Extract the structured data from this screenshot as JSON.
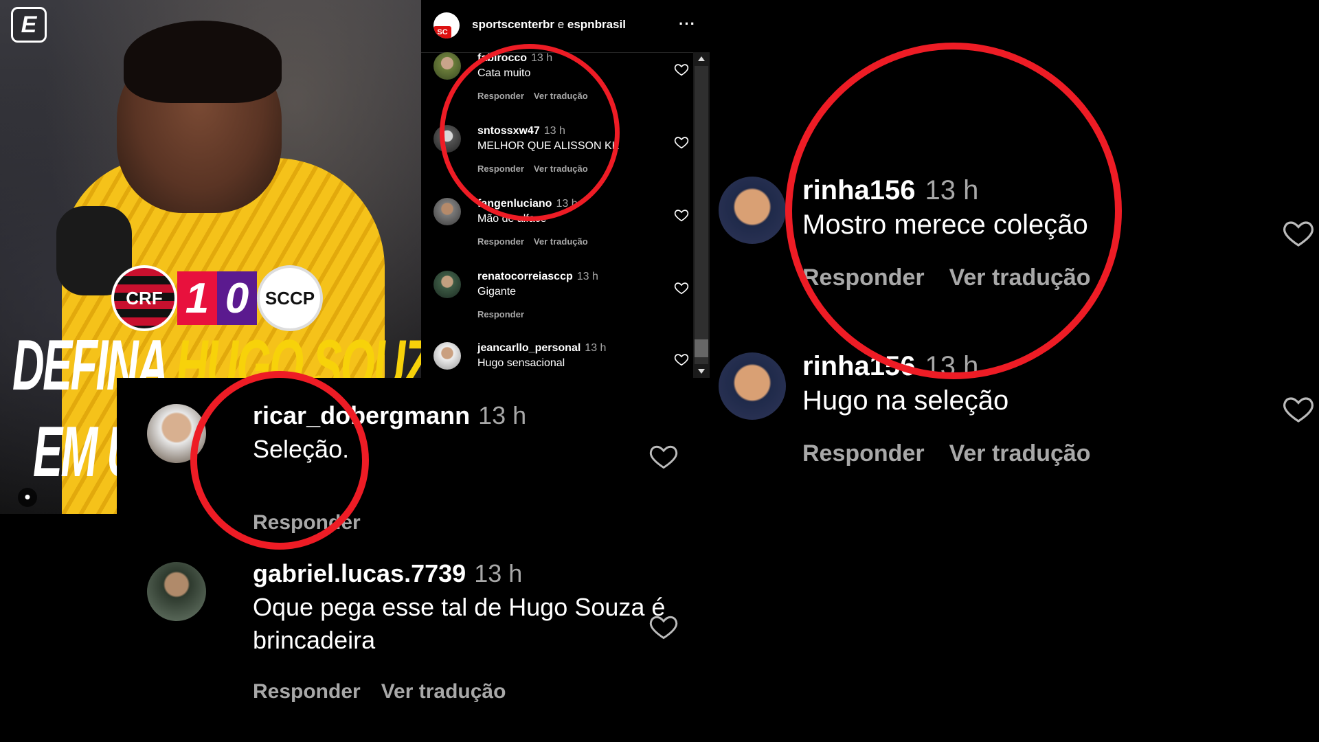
{
  "post": {
    "logo": "E",
    "score": {
      "home": "1",
      "away": "0"
    },
    "headline_line1_a": "DEFINA ",
    "headline_line1_b": "HUGO SOUZA",
    "headline_line2": "EM UMA"
  },
  "small_panel": {
    "account_primary": "sportscenterbr",
    "account_joiner": " e ",
    "account_secondary": "espnbrasil",
    "avatar_text": "SC",
    "more": "···",
    "comments": [
      {
        "user": "fabirocco",
        "time": "13 h",
        "text": "Cata muito",
        "reply": "Responder",
        "translate": "Ver tradução"
      },
      {
        "user": "sntossxw47",
        "time": "13 h",
        "text": "MELHOR QUE ALISSON KK",
        "reply": "Responder",
        "translate": "Ver tradução"
      },
      {
        "user": "fangenluciano",
        "time": "13 h",
        "text": "Mão de alface",
        "reply": "Responder",
        "translate": "Ver tradução"
      },
      {
        "user": "renatocorreiasccp",
        "time": "13 h",
        "text": "Gigante",
        "reply": "Responder"
      },
      {
        "user": "jeancarllo_personal",
        "time": "13 h",
        "text": "Hugo sensacional"
      }
    ]
  },
  "zoom_left": {
    "comments": [
      {
        "user": "ricar_dobergmann",
        "time": "13 h",
        "text": "Seleção.",
        "reply": "Responder"
      },
      {
        "user": "gabriel.lucas.7739",
        "time": "13 h",
        "text": "Oque pega esse tal de Hugo Souza é brincadeira",
        "reply": "Responder",
        "translate": "Ver tradução"
      }
    ]
  },
  "zoom_right": {
    "comments": [
      {
        "user": "rinha156",
        "time": "13 h",
        "text": "Mostro merece coleção",
        "reply": "Responder",
        "translate": "Ver tradução"
      },
      {
        "user": "rinha156",
        "time": "13 h",
        "text": "Hugo na seleção",
        "reply": "Responder",
        "translate": "Ver tradução"
      }
    ]
  },
  "colors": {
    "highlight_ring": "#ee1c25",
    "muted_text": "#a8a8a8",
    "headline_yellow": "#f7d20a"
  },
  "icons": [
    "heart-icon",
    "more-icon",
    "user-tag-icon",
    "scroll-up-icon",
    "scroll-down-icon"
  ]
}
